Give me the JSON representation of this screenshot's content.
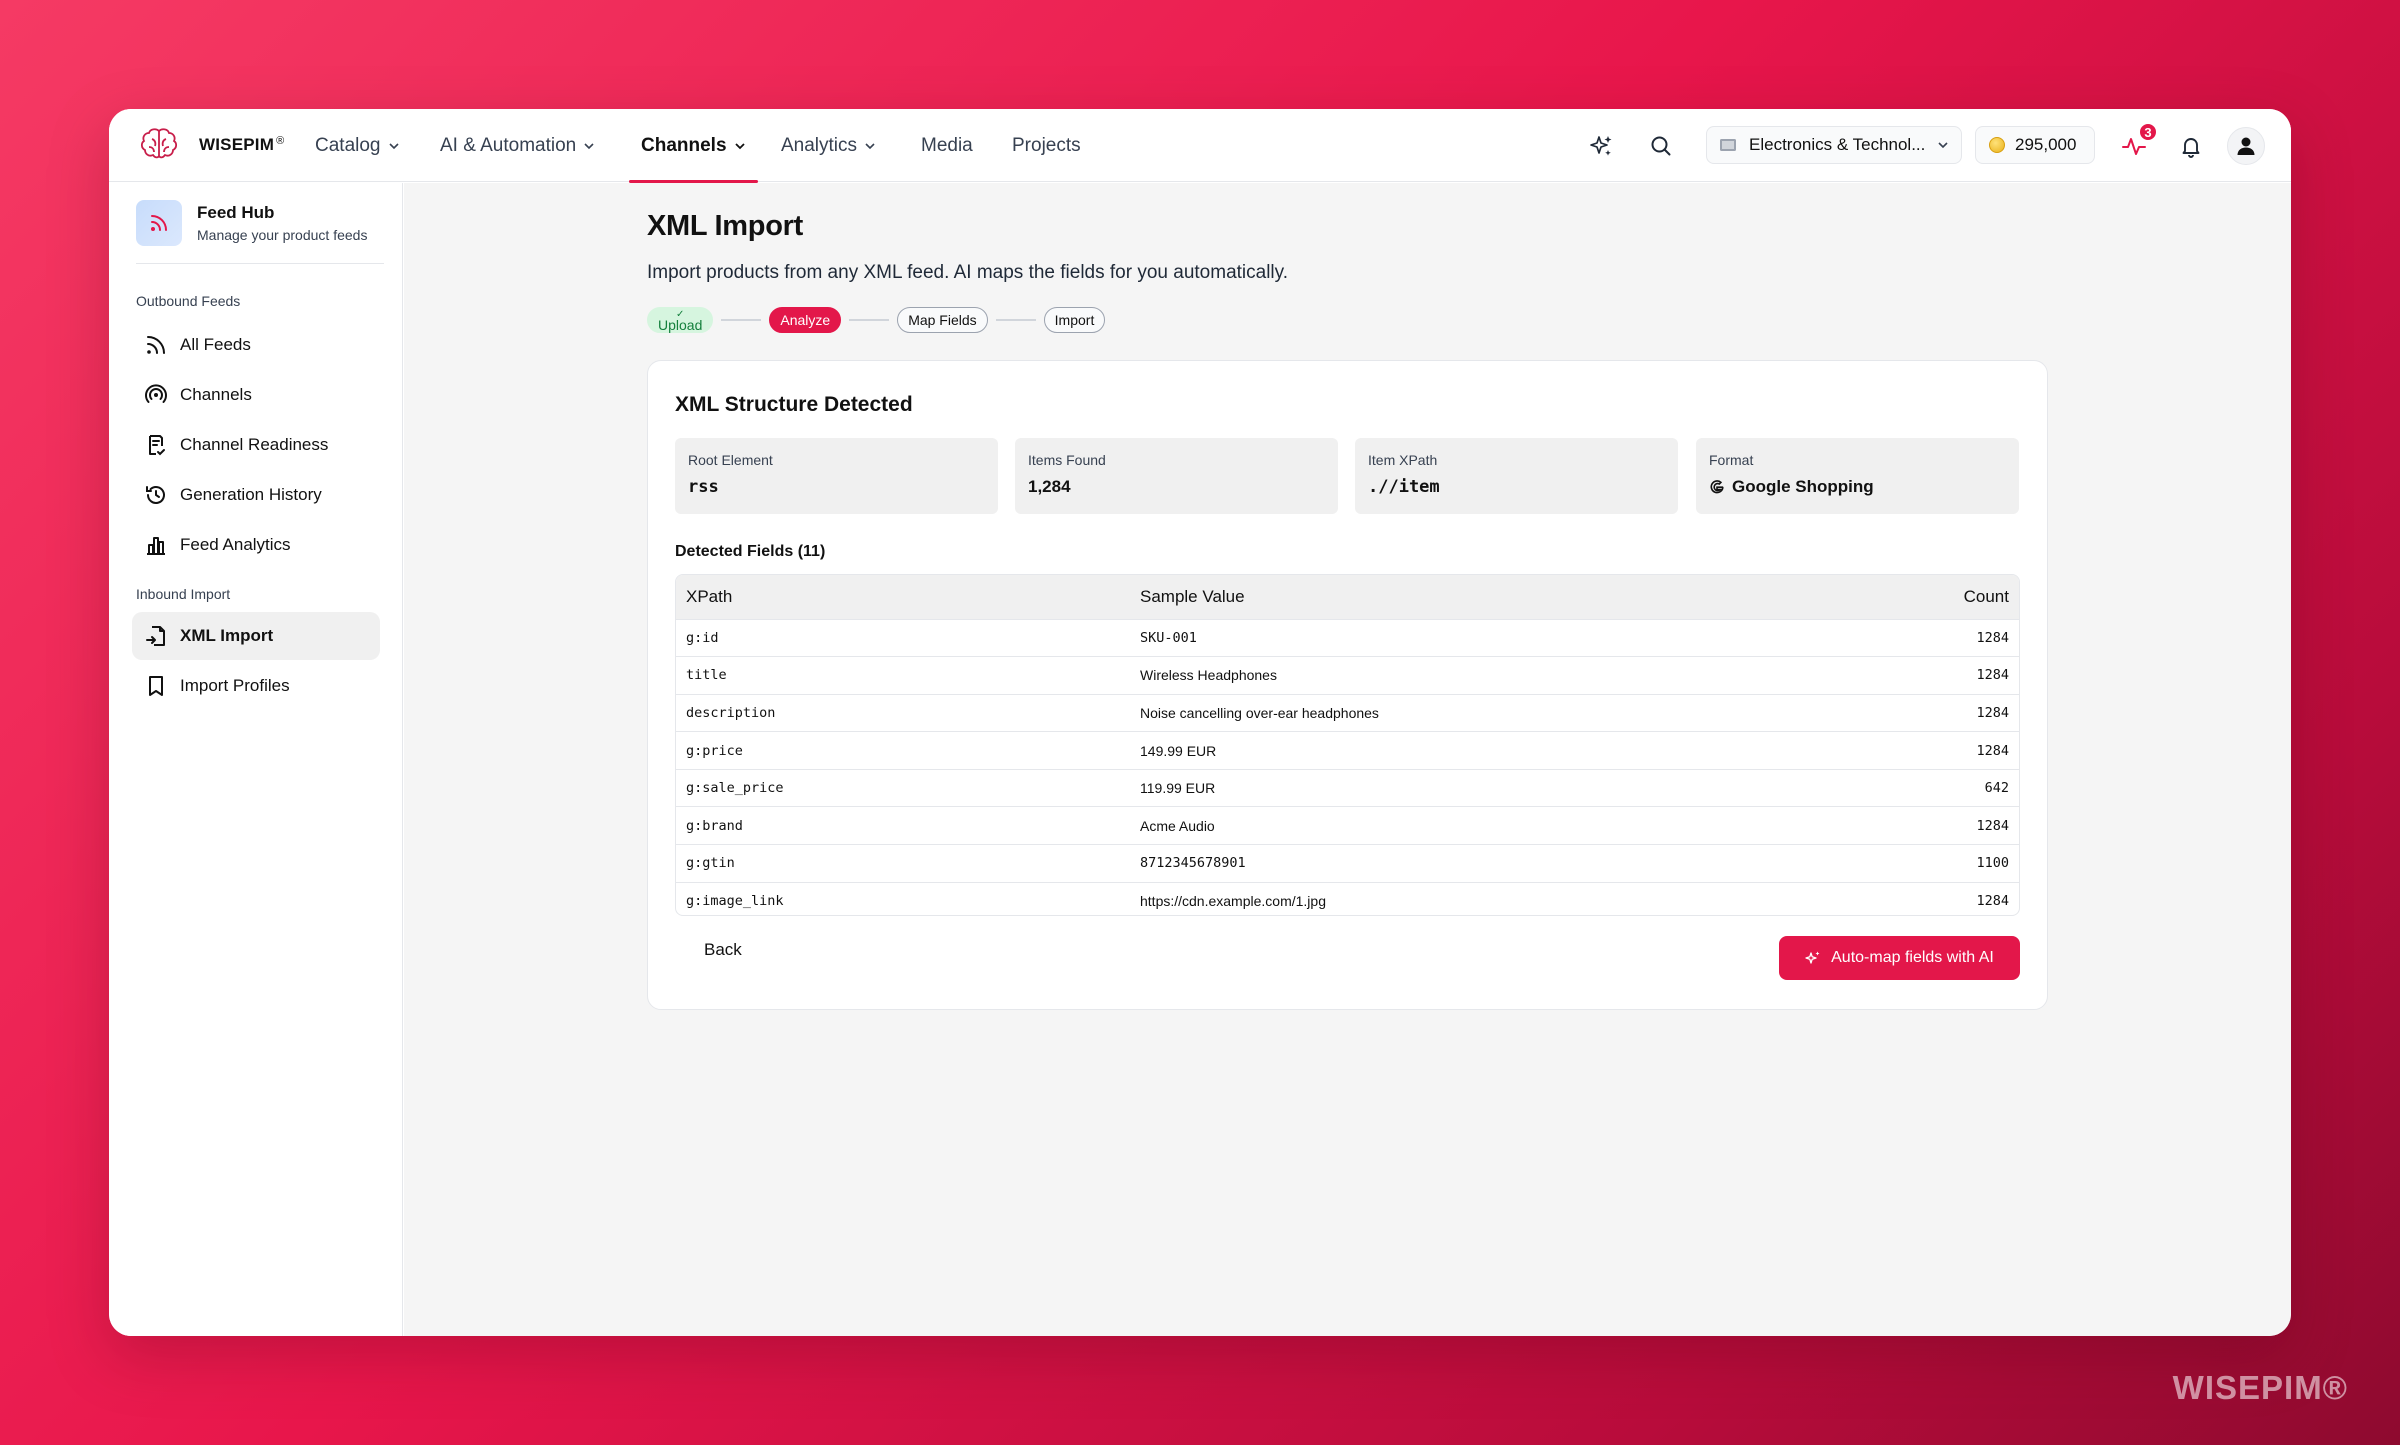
{
  "brand": {
    "name": "WISEPIM",
    "reg": "®",
    "watermark": "WISEPIM®"
  },
  "nav": {
    "items": [
      {
        "label": "Catalog",
        "dropdown": true
      },
      {
        "label": "AI & Automation",
        "dropdown": true
      },
      {
        "label": "Channels",
        "dropdown": true,
        "active": true
      },
      {
        "label": "Analytics",
        "dropdown": true
      },
      {
        "label": "Media",
        "dropdown": false
      },
      {
        "label": "Projects",
        "dropdown": false
      }
    ],
    "workspace": "Electronics & Technol...",
    "credits": "295,000",
    "activity_badge": "3",
    "accent": "#e3174a"
  },
  "sidebar": {
    "hub_title": "Feed Hub",
    "hub_subtitle": "Manage your product feeds",
    "outbound_label": "Outbound Feeds",
    "outbound_items": [
      {
        "label": "All Feeds",
        "icon": "rss-icon"
      },
      {
        "label": "Channels",
        "icon": "broadcast-icon"
      },
      {
        "label": "Channel Readiness",
        "icon": "clipboard-check-icon"
      },
      {
        "label": "Generation History",
        "icon": "history-icon"
      },
      {
        "label": "Feed Analytics",
        "icon": "bar-chart-icon"
      }
    ],
    "inbound_label": "Inbound Import",
    "inbound_items": [
      {
        "label": "XML Import",
        "icon": "file-import-icon",
        "active": true
      },
      {
        "label": "Import Profiles",
        "icon": "bookmark-icon"
      }
    ]
  },
  "page": {
    "title": "XML Import",
    "subtitle": "Import products from any XML feed. AI maps the fields for you automatically.",
    "steps": [
      {
        "label": "Upload",
        "state": "done"
      },
      {
        "label": "Analyze",
        "state": "current"
      },
      {
        "label": "Map Fields",
        "state": "pending"
      },
      {
        "label": "Import",
        "state": "pending"
      }
    ]
  },
  "card": {
    "title": "XML Structure Detected",
    "stats": [
      {
        "label": "Root Element",
        "value": "rss"
      },
      {
        "label": "Items Found",
        "value": "1,284"
      },
      {
        "label": "Item XPath",
        "value": ".//item"
      },
      {
        "label": "Format",
        "value": "Google Shopping"
      }
    ],
    "detected_label": "Detected Fields (11)",
    "table": {
      "headers": [
        "XPath",
        "Sample Value",
        "Count"
      ],
      "rows": [
        [
          "g:id",
          "SKU-001",
          "1284"
        ],
        [
          "title",
          "Wireless Headphones",
          "1284"
        ],
        [
          "description",
          "Noise cancelling over-ear headphones",
          "1284"
        ],
        [
          "g:price",
          "149.99 EUR",
          "1284"
        ],
        [
          "g:sale_price",
          "119.99 EUR",
          "642"
        ],
        [
          "g:brand",
          "Acme Audio",
          "1284"
        ],
        [
          "g:gtin",
          "8712345678901",
          "1100"
        ],
        [
          "g:image_link",
          "https://cdn.example.com/1.jpg",
          "1284"
        ]
      ]
    },
    "back_label": "Back",
    "ai_button_label": "Auto-map fields with AI"
  }
}
